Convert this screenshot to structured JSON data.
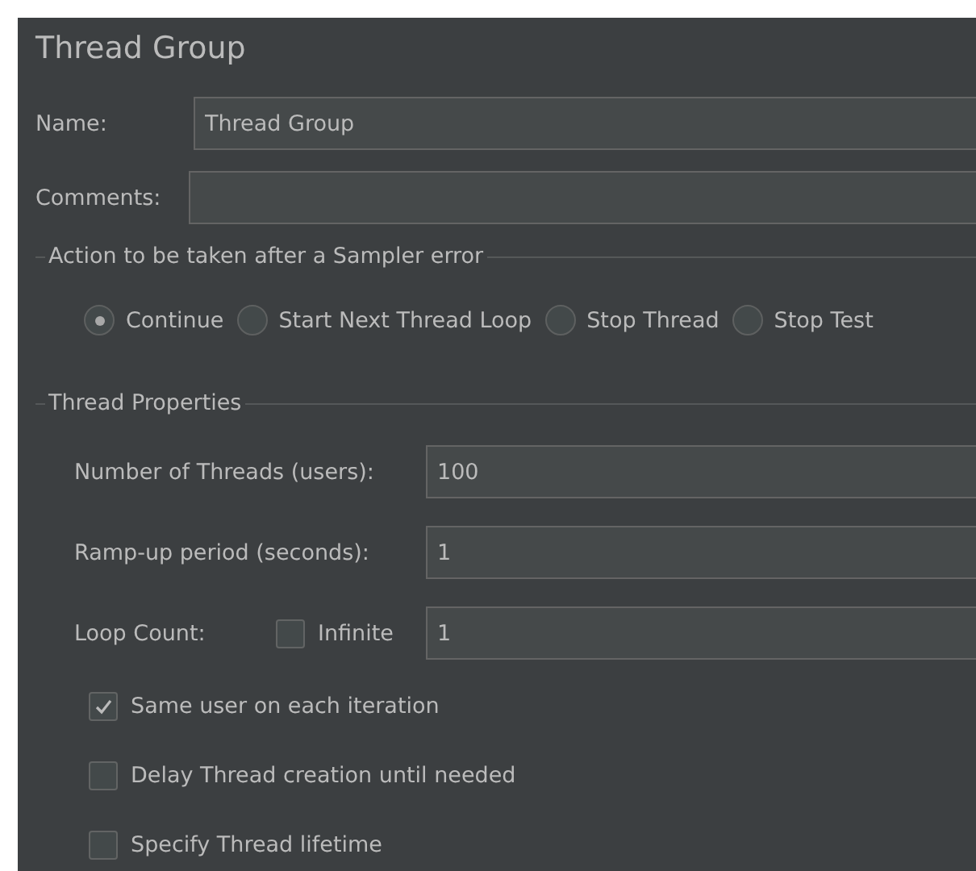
{
  "title": "Thread Group",
  "name": {
    "label": "Name:",
    "value": "Thread Group"
  },
  "comments": {
    "label": "Comments:"
  },
  "sampler_error": {
    "legend": "Action to be taken after a Sampler error",
    "options": [
      {
        "label": "Continue",
        "selected": true
      },
      {
        "label": "Start Next Thread Loop",
        "selected": false
      },
      {
        "label": "Stop Thread",
        "selected": false
      },
      {
        "label": "Stop Test",
        "selected": false
      }
    ]
  },
  "thread_properties": {
    "legend": "Thread Properties",
    "fields": [
      {
        "label": "Number of Threads (users):",
        "value": "100"
      },
      {
        "label": "Ramp-up period (seconds):",
        "value": "1"
      }
    ],
    "loop_count": {
      "label": "Loop Count:",
      "infinite": {
        "label": "Infinite",
        "checked": false
      },
      "value": "1"
    },
    "options": [
      {
        "label": "Same user on each iteration",
        "checked": true
      },
      {
        "label": "Delay Thread creation until needed",
        "checked": false
      },
      {
        "label": "Specify Thread lifetime",
        "checked": false
      }
    ]
  }
}
